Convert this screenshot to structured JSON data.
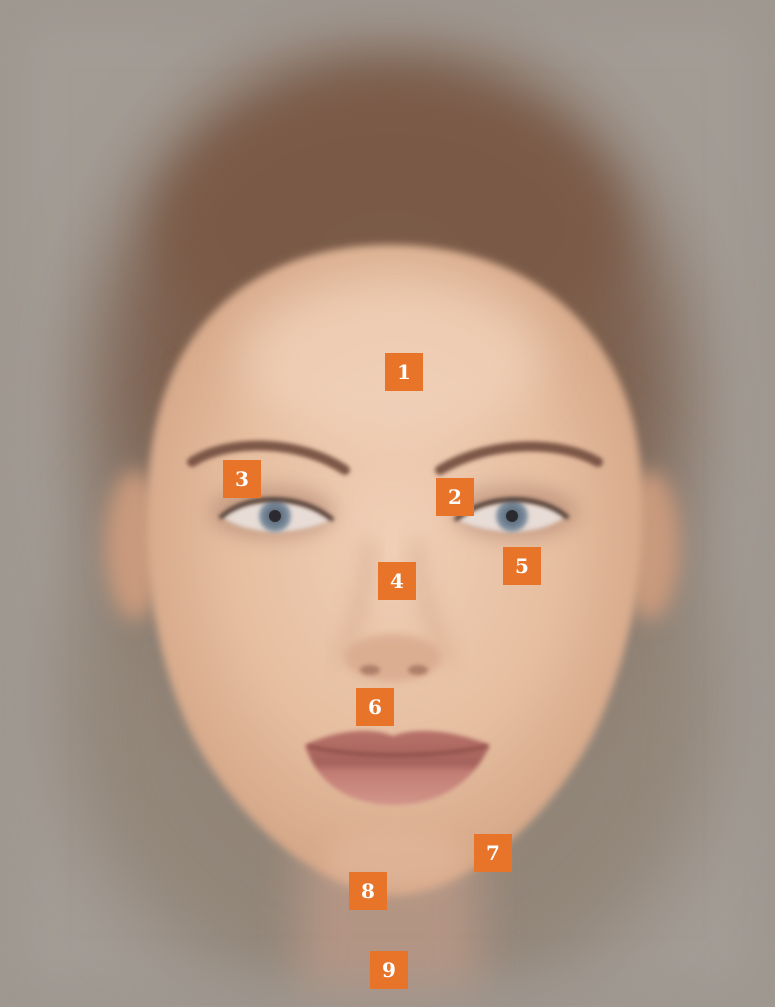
{
  "image": {
    "subject": "averaged-face",
    "background_color": "#a39c95",
    "hair_color": "#7d5f4c",
    "skin_color": "#e8c0a4",
    "lip_color": "#c27d74",
    "eye_color": "#6e7f90"
  },
  "markers": {
    "color": "#e8742a",
    "text_color": "#ffffff",
    "items": [
      {
        "label": "1"
      },
      {
        "label": "2"
      },
      {
        "label": "3"
      },
      {
        "label": "4"
      },
      {
        "label": "5"
      },
      {
        "label": "6"
      },
      {
        "label": "7"
      },
      {
        "label": "8"
      },
      {
        "label": "9"
      }
    ]
  }
}
